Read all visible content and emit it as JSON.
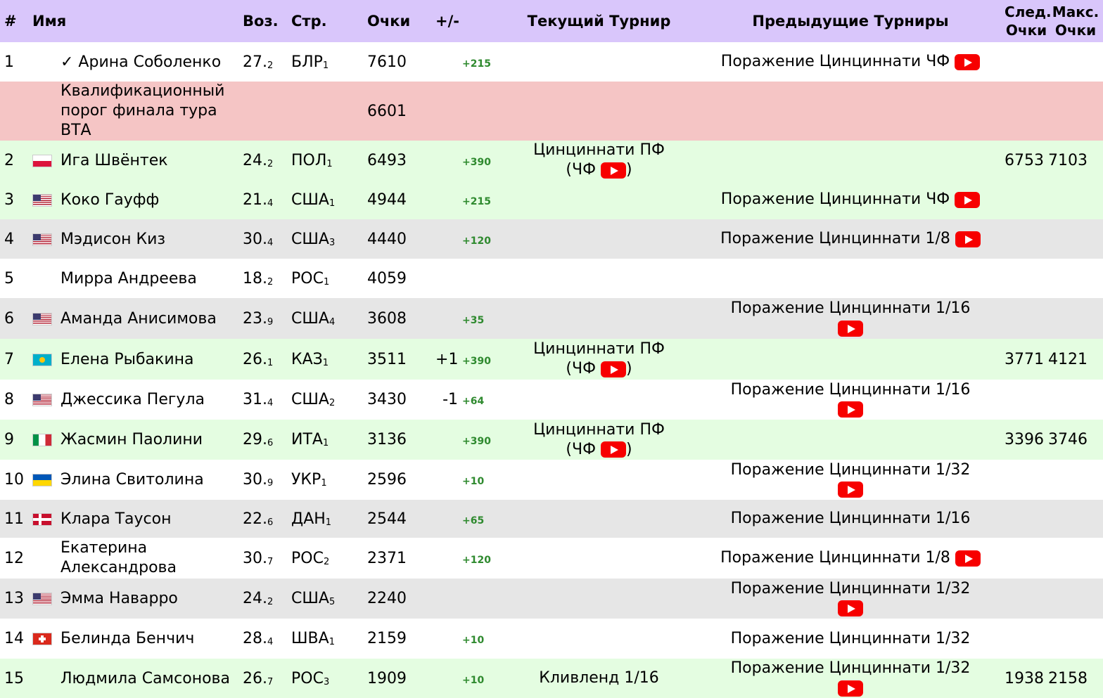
{
  "colors": {
    "header_bg": "#d9c6fb",
    "accent_line": "#b58cf0",
    "green_row": "#e4fde1",
    "red_row": "#f5c5c5",
    "grey_row": "#e6e6e6",
    "delta_green": "#2f8a2f",
    "youtube_red": "#f70000"
  },
  "headers": {
    "num": "#",
    "name": "Имя",
    "age": "Воз.",
    "country": "Стр.",
    "points": "Очки",
    "change": "+/-",
    "current": "Текущий Турнир",
    "previous": "Предыдущие Турниры",
    "next_line1": "След.",
    "next_line2": "Очки",
    "max_line1": "Макс.",
    "max_line2": "Очки"
  },
  "cutoff": {
    "label_line1": "Квалификационный",
    "label_line2": "порог финала тура ВТА",
    "points": "6601"
  },
  "rows": [
    {
      "rank": "1",
      "flag": "",
      "name": "✓ Арина Соболенко",
      "age": "27.",
      "age_dec": "2",
      "country": "БЛР",
      "country_rank": "1",
      "points": "7610",
      "change": "",
      "delta": "+215",
      "current": "",
      "previous": "Поражение Цинциннати ЧФ",
      "prev_video": "inline",
      "next": "",
      "max": ""
    },
    {
      "rank": "2",
      "flag": "poland-flag-icon",
      "name": "Ига Швёнтек",
      "age": "24.",
      "age_dec": "2",
      "country": "ПОЛ",
      "country_rank": "1",
      "points": "6493",
      "change": "",
      "delta": "+390",
      "current": "Цинциннати ПФ",
      "current_extra": "(ЧФ",
      "previous": "",
      "next": "6753",
      "max": "7103"
    },
    {
      "rank": "3",
      "flag": "usa-flag-icon",
      "name": "Коко Гауфф",
      "age": "21.",
      "age_dec": "4",
      "country": "США",
      "country_rank": "1",
      "points": "4944",
      "change": "",
      "delta": "+215",
      "current": "",
      "previous": "Поражение Цинциннати ЧФ",
      "prev_video": "inline",
      "next": "",
      "max": ""
    },
    {
      "rank": "4",
      "flag": "usa-flag-icon",
      "name": "Мэдисон Киз",
      "age": "30.",
      "age_dec": "4",
      "country": "США",
      "country_rank": "3",
      "points": "4440",
      "change": "",
      "delta": "+120",
      "current": "",
      "previous": "Поражение Цинциннати 1/8",
      "prev_video": "inline",
      "next": "",
      "max": ""
    },
    {
      "rank": "5",
      "flag": "",
      "name": "Мирра Андреева",
      "age": "18.",
      "age_dec": "2",
      "country": "РОС",
      "country_rank": "1",
      "points": "4059",
      "change": "",
      "delta": "",
      "current": "",
      "previous": "",
      "next": "",
      "max": ""
    },
    {
      "rank": "6",
      "flag": "usa-flag-icon",
      "name": "Аманда Анисимова",
      "age": "23.",
      "age_dec": "9",
      "country": "США",
      "country_rank": "4",
      "points": "3608",
      "change": "",
      "delta": "+35",
      "current": "",
      "previous": "Поражение Цинциннати 1/16",
      "prev_video": "below",
      "next": "",
      "max": ""
    },
    {
      "rank": "7",
      "flag": "kazakhstan-flag-icon",
      "name": "Елена Рыбакина",
      "age": "26.",
      "age_dec": "1",
      "country": "КАЗ",
      "country_rank": "1",
      "points": "3511",
      "change": "+1",
      "delta": "+390",
      "current": "Цинциннати ПФ",
      "current_extra": "(ЧФ",
      "previous": "",
      "next": "3771",
      "max": "4121"
    },
    {
      "rank": "8",
      "flag": "usa-flag-icon",
      "name": "Джессика Пегула",
      "age": "31.",
      "age_dec": "4",
      "country": "США",
      "country_rank": "2",
      "points": "3430",
      "change": "-1",
      "delta": "+64",
      "current": "",
      "previous": "Поражение Цинциннати 1/16",
      "prev_video": "below",
      "next": "",
      "max": ""
    },
    {
      "rank": "9",
      "flag": "italy-flag-icon",
      "name": "Жасмин Паолини",
      "age": "29.",
      "age_dec": "6",
      "country": "ИТА",
      "country_rank": "1",
      "points": "3136",
      "change": "",
      "delta": "+390",
      "current": "Цинциннати ПФ",
      "current_extra": "(ЧФ",
      "previous": "",
      "next": "3396",
      "max": "3746"
    },
    {
      "rank": "10",
      "flag": "ukraine-flag-icon",
      "name": "Элина Свитолина",
      "age": "30.",
      "age_dec": "9",
      "country": "УКР",
      "country_rank": "1",
      "points": "2596",
      "change": "",
      "delta": "+10",
      "current": "",
      "previous": "Поражение Цинциннати 1/32",
      "prev_video": "below",
      "next": "",
      "max": ""
    },
    {
      "rank": "11",
      "flag": "denmark-flag-icon",
      "name": "Клара Таусон",
      "age": "22.",
      "age_dec": "6",
      "country": "ДАН",
      "country_rank": "1",
      "points": "2544",
      "change": "",
      "delta": "+65",
      "current": "",
      "previous": "Поражение Цинциннати 1/16",
      "prev_video": "none",
      "next": "",
      "max": ""
    },
    {
      "rank": "12",
      "flag": "",
      "name": "Екатерина Александрова",
      "name_line1": "Екатерина",
      "name_line2": "Александрова",
      "age": "30.",
      "age_dec": "7",
      "country": "РОС",
      "country_rank": "2",
      "points": "2371",
      "change": "",
      "delta": "+120",
      "current": "",
      "previous": "Поражение Цинциннати 1/8",
      "prev_video": "inline",
      "next": "",
      "max": ""
    },
    {
      "rank": "13",
      "flag": "usa-flag-icon",
      "name": "Эмма Наварро",
      "age": "24.",
      "age_dec": "2",
      "country": "США",
      "country_rank": "5",
      "points": "2240",
      "change": "",
      "delta": "",
      "current": "",
      "previous": "Поражение Цинциннати 1/32",
      "prev_video": "below",
      "next": "",
      "max": ""
    },
    {
      "rank": "14",
      "flag": "switzerland-flag-icon",
      "name": "Белинда Бенчич",
      "age": "28.",
      "age_dec": "4",
      "country": "ШВА",
      "country_rank": "1",
      "points": "2159",
      "change": "",
      "delta": "+10",
      "current": "",
      "previous": "Поражение Цинциннати 1/32",
      "prev_video": "none",
      "next": "",
      "max": ""
    },
    {
      "rank": "15",
      "flag": "",
      "name": "Людмила Самсонова",
      "age": "26.",
      "age_dec": "7",
      "country": "РОС",
      "country_rank": "3",
      "points": "1909",
      "change": "",
      "delta": "+10",
      "current": "Кливленд 1/16",
      "previous": "Поражение Цинциннати 1/32",
      "prev_video": "below",
      "next": "1938",
      "max": "2158"
    }
  ]
}
